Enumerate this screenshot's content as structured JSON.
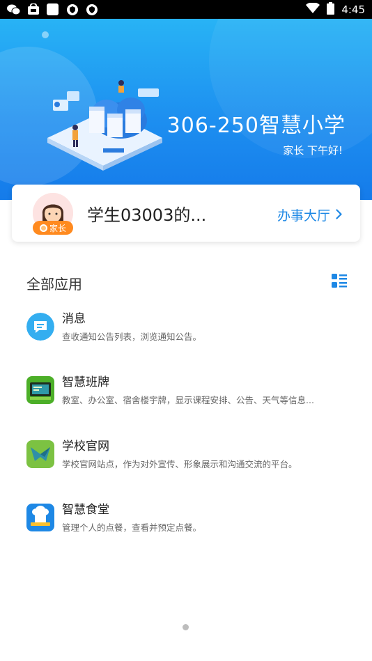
{
  "status_bar": {
    "time": "4:45",
    "left_icons": [
      "wechat-icon",
      "bag-icon",
      "square-icon",
      "shield-icon",
      "shield-icon"
    ],
    "right_icons": [
      "wifi-icon",
      "battery-icon"
    ]
  },
  "header": {
    "school_name": "306-250智慧小学",
    "greeting": "家长 下午好!"
  },
  "user": {
    "name": "学生03003的...",
    "role": "家长",
    "service_link": "办事大厅",
    "service_chevron": "›"
  },
  "section": {
    "title": "全部应用"
  },
  "apps": [
    {
      "title": "消息",
      "desc": "查收通知公告列表，浏览通知公告。",
      "icon": "message-icon"
    },
    {
      "title": "智慧班牌",
      "desc": "教室、办公室、宿舍楼宇牌，显示课程安排、公告、天气等信息...",
      "icon": "class-board-icon"
    },
    {
      "title": "学校官网",
      "desc": "学校官网站点，作为对外宣传、形象展示和沟通交流的平台。",
      "icon": "website-icon"
    },
    {
      "title": "智慧食堂",
      "desc": "管理个人的点餐，查看并预定点餐。",
      "icon": "canteen-icon"
    }
  ],
  "colors": {
    "accent": "#1e88e5",
    "hero_top": "#28b3f5",
    "hero_bottom": "#157bea",
    "badge": "#ff8a1f"
  }
}
